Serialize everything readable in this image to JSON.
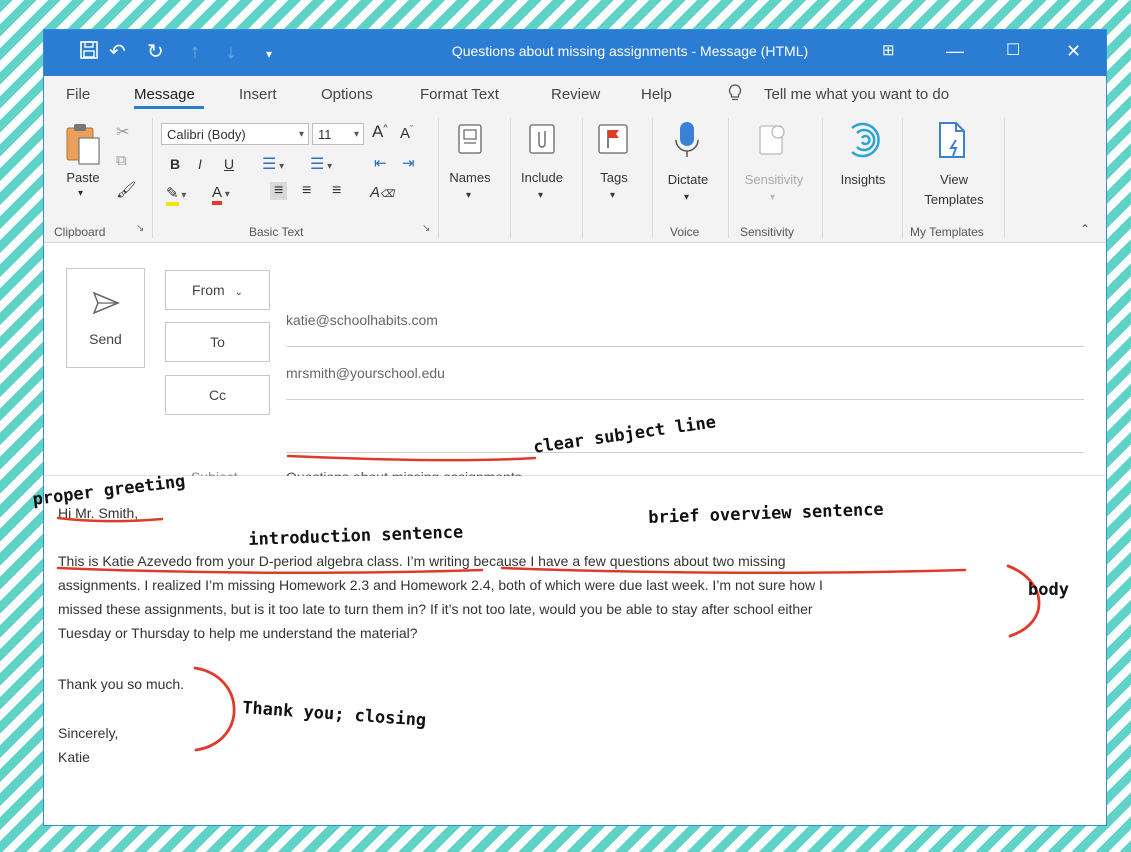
{
  "window": {
    "title": "Questions about missing assignments - Message (HTML)"
  },
  "menu": {
    "items": [
      "File",
      "Message",
      "Insert",
      "Options",
      "Format Text",
      "Review",
      "Help"
    ],
    "active": "Message",
    "tell_me": "Tell me what you want to do"
  },
  "ribbon": {
    "clipboard": {
      "paste": "Paste",
      "group": "Clipboard"
    },
    "basic_text": {
      "font": "Calibri (Body)",
      "size": "11",
      "group": "Basic Text"
    },
    "names": "Names",
    "include": "Include",
    "tags": "Tags",
    "voice": {
      "dictate": "Dictate",
      "group": "Voice"
    },
    "sensitivity": {
      "button": "Sensitivity",
      "group": "Sensitivity"
    },
    "insights": "Insights",
    "templates": {
      "view": "View",
      "templates": "Templates",
      "group": "My Templates"
    }
  },
  "compose": {
    "send": "Send",
    "from_label": "From",
    "from_value": "katie@schoolhabits.com",
    "to_label": "To",
    "to_value": "mrsmith@yourschool.edu",
    "cc_label": "Cc",
    "cc_value": "",
    "subject_label": "Subject",
    "subject_value": "Questions about missing assignments"
  },
  "body": {
    "greeting": "Hi Mr. Smith,",
    "intro": "This is Katie Azevedo from your D-period algebra class.",
    "paragraph_line1_rest": " I’m writing because I have a few questions about two missing",
    "paragraph_line2": "assignments. I realized I’m missing Homework 2.3 and Homework 2.4, both of which were due last week. I’m not sure how I",
    "paragraph_line3": "missed these assignments, but is it too late to turn them in? If it’s not too late, would you be able to stay after school either",
    "paragraph_line4": "Tuesday or Thursday to help me understand the material?",
    "thanks": "Thank you so much.",
    "signoff": "Sincerely,",
    "name": "Katie"
  },
  "annotations": {
    "subject": "clear subject line",
    "greeting": "proper greeting",
    "intro": "introduction sentence",
    "overview": "brief overview sentence",
    "body": "body",
    "closing": "Thank you; closing"
  },
  "colors": {
    "title_bar": "#2b7cd3",
    "stripe": "#5fd3c8",
    "annotation_red": "#e03a2a"
  }
}
